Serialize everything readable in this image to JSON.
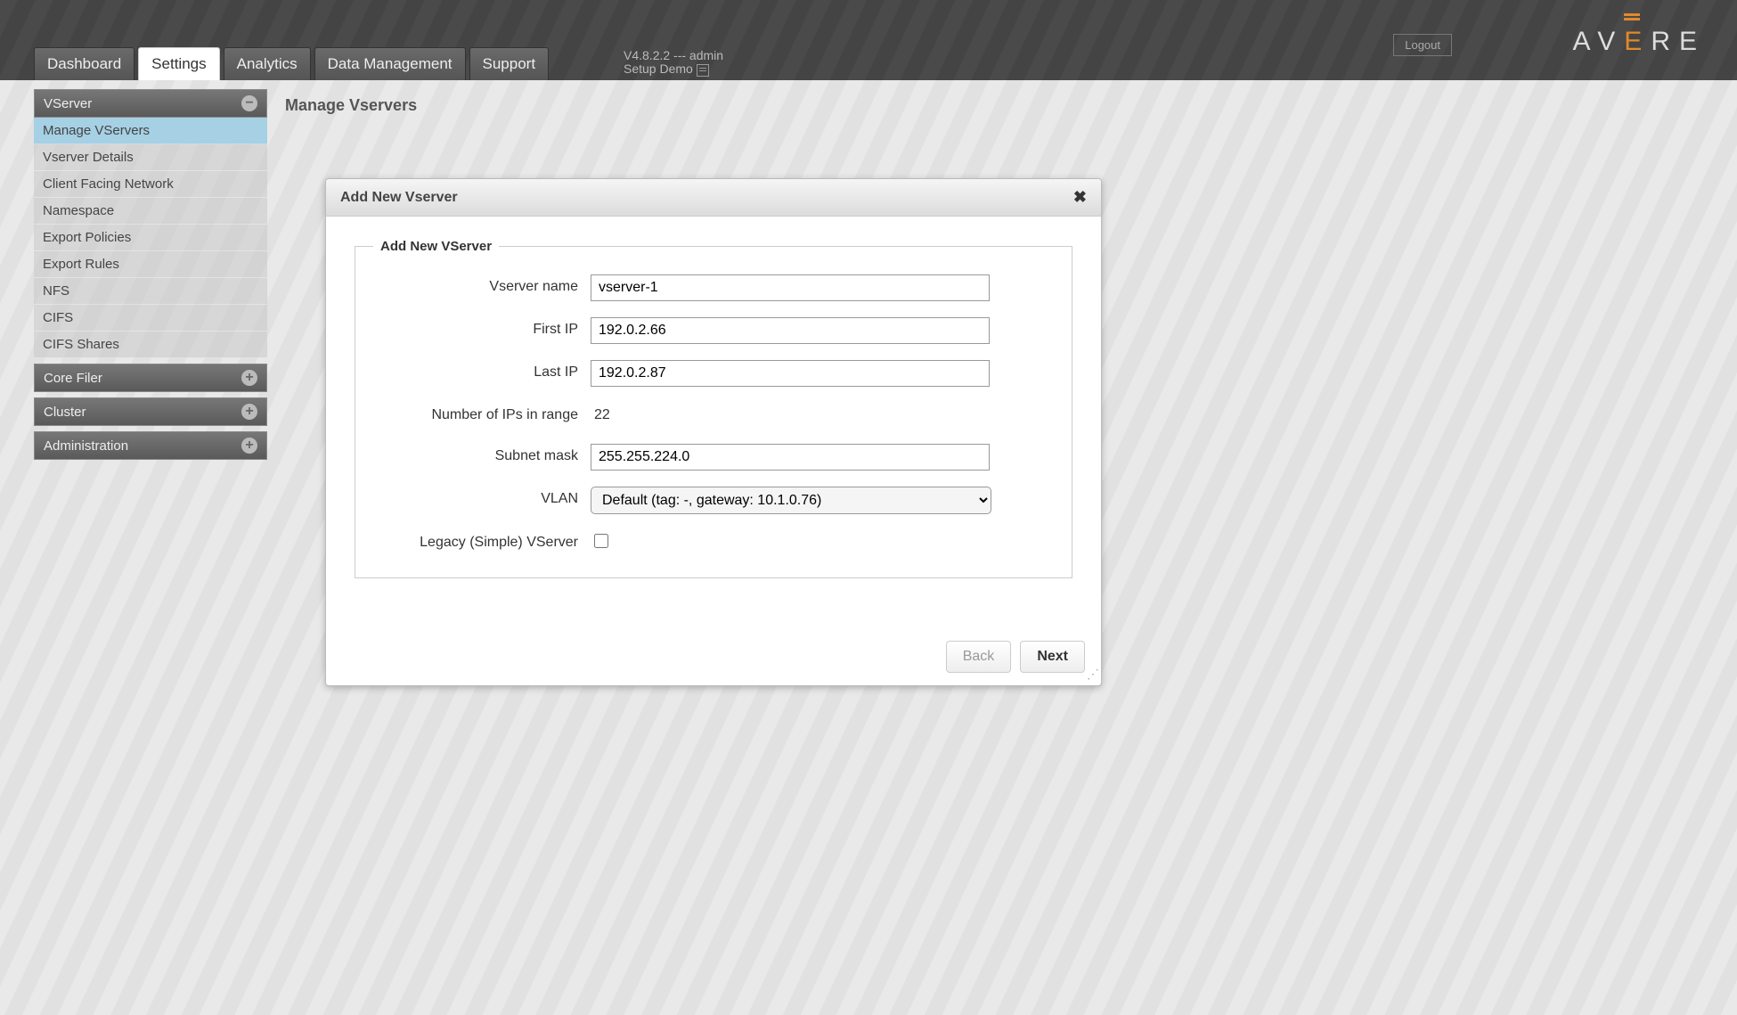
{
  "header": {
    "tabs": [
      "Dashboard",
      "Settings",
      "Analytics",
      "Data Management",
      "Support"
    ],
    "active_tab_index": 1,
    "version_line": "V4.8.2.2 --- admin",
    "setup_line": "Setup Demo",
    "logout_label": "Logout",
    "logo_letters": [
      "A",
      "V",
      "E",
      "R",
      "E"
    ]
  },
  "sidebar": {
    "sections": [
      {
        "title": "VServer",
        "expanded": true,
        "icon": "minus",
        "items": [
          "Manage VServers",
          "Vserver Details",
          "Client Facing Network",
          "Namespace",
          "Export Policies",
          "Export Rules",
          "NFS",
          "CIFS",
          "CIFS Shares"
        ],
        "active_item_index": 0
      },
      {
        "title": "Core Filer",
        "expanded": false,
        "icon": "plus",
        "items": []
      },
      {
        "title": "Cluster",
        "expanded": false,
        "icon": "plus",
        "items": []
      },
      {
        "title": "Administration",
        "expanded": false,
        "icon": "plus",
        "items": []
      }
    ]
  },
  "page": {
    "title": "Manage Vservers"
  },
  "dialog": {
    "title": "Add New Vserver",
    "legend": "Add New VServer",
    "close_glyph": "✖",
    "fields": {
      "vserver_name": {
        "label": "Vserver name",
        "value": "vserver-1"
      },
      "first_ip": {
        "label": "First IP",
        "value": "192.0.2.66"
      },
      "last_ip": {
        "label": "Last IP",
        "value": "192.0.2.87"
      },
      "ip_count": {
        "label": "Number of IPs in range",
        "value": "22"
      },
      "subnet_mask": {
        "label": "Subnet mask",
        "value": "255.255.224.0"
      },
      "vlan": {
        "label": "VLAN",
        "selected": "Default (tag: -, gateway: 10.1.0.76)"
      },
      "legacy": {
        "label": "Legacy (Simple) VServer",
        "checked": false
      }
    },
    "buttons": {
      "back": "Back",
      "next": "Next"
    }
  }
}
